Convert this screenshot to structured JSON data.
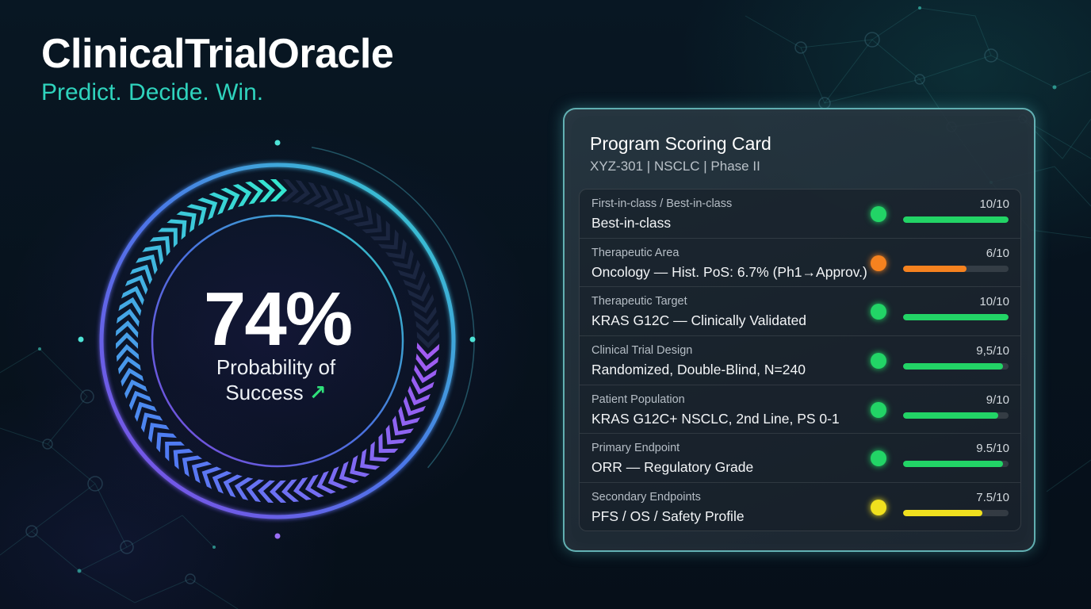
{
  "brand": {
    "title": "ClinicalTrialOracle",
    "tagline": "Predict. Decide. Win."
  },
  "gauge": {
    "value_text": "74%",
    "value_fraction": 0.74,
    "caption_line1": "Probability of",
    "caption_line2": "Success",
    "trend_icon": "trend-up-arrow-icon",
    "trend_glyph": "↗",
    "colors": {
      "start": "#a15cf2",
      "mid": "#4f7cf3",
      "end": "#35e6d0",
      "track": "#1b2640"
    }
  },
  "card": {
    "title": "Program Scoring Card",
    "subtitle": "XYZ-301 | NSCLC | Phase II",
    "rows": [
      {
        "label": "First-in-class / Best-in-class",
        "value": "Best-in-class",
        "score_text": "10/10",
        "score": 10,
        "max": 10,
        "status": "green"
      },
      {
        "label": "Therapeutic Area",
        "value": "Oncology — Hist. PoS: 6.7% (Ph1→Approv.)",
        "score_text": "6/10",
        "score": 6,
        "max": 10,
        "status": "orange"
      },
      {
        "label": "Therapeutic Target",
        "value": "KRAS G12C — Clinically Validated",
        "score_text": "10/10",
        "score": 10,
        "max": 10,
        "status": "green"
      },
      {
        "label": "Clinical Trial Design",
        "value": "Randomized, Double-Blind, N=240",
        "score_text": "9,5/10",
        "score": 9.5,
        "max": 10,
        "status": "green"
      },
      {
        "label": "Patient Population",
        "value": "KRAS G12C+ NSCLC, 2nd Line, PS 0-1",
        "score_text": "9/10",
        "score": 9,
        "max": 10,
        "status": "green"
      },
      {
        "label": "Primary Endpoint",
        "value": "ORR — Regulatory Grade",
        "score_text": "9.5/10",
        "score": 9.5,
        "max": 10,
        "status": "green"
      },
      {
        "label": "Secondary Endpoints",
        "value": "PFS / OS / Safety Profile",
        "score_text": "7.5/10",
        "score": 7.5,
        "max": 10,
        "status": "yellow"
      }
    ],
    "status_colors": {
      "green": "#22d466",
      "orange": "#f5821f",
      "yellow": "#f0e01e"
    }
  }
}
